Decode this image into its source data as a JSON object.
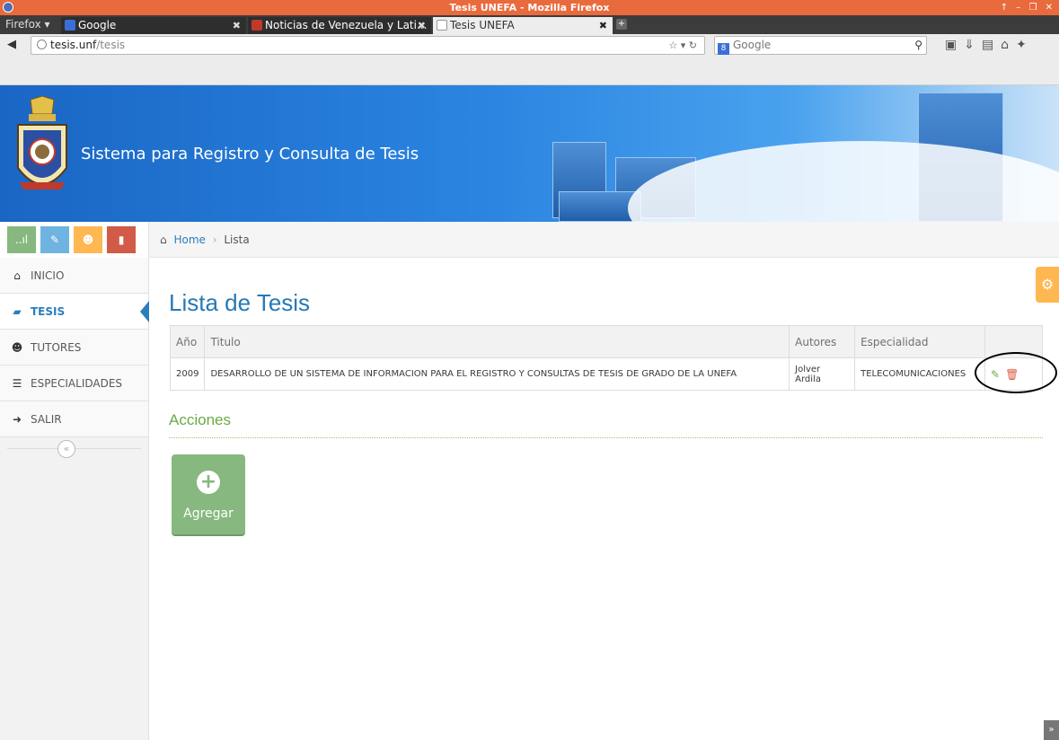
{
  "window": {
    "title": "Tesis UNEFA - Mozilla Firefox",
    "controls": "↑ – ❐ ✕"
  },
  "browser": {
    "menu_label": "Firefox ▾",
    "tabs": [
      {
        "label": "Google",
        "favicon_color": "#3b6fd8"
      },
      {
        "label": "Noticias de Venezuela y Lati...",
        "favicon_color": "#c0392b"
      },
      {
        "label": "Tesis UNEFA",
        "favicon_color": "#ffffff"
      }
    ],
    "url_host": "tesis.unf",
    "url_path": "/tesis",
    "url_controls": "☆ ▾ ↻",
    "search_engine_badge": "8",
    "search_placeholder": "Google"
  },
  "banner": {
    "site_title": "Sistema para Registro y Consulta de Tesis"
  },
  "sidebar": {
    "shortcuts": [
      {
        "name": "stats",
        "color": "#87b87f",
        "glyph": "..ıl"
      },
      {
        "name": "pencil",
        "color": "#6fb3e0",
        "glyph": "✎"
      },
      {
        "name": "users",
        "color": "#ffb752",
        "glyph": "☻"
      },
      {
        "name": "book",
        "color": "#d15b47",
        "glyph": "▮"
      }
    ],
    "items": [
      {
        "label": "INICIO",
        "icon": "home-icon",
        "glyph": "⌂"
      },
      {
        "label": "TESIS",
        "icon": "book-icon",
        "glyph": "▰"
      },
      {
        "label": "TUTORES",
        "icon": "group-icon",
        "glyph": "☻"
      },
      {
        "label": "ESPECIALIDADES",
        "icon": "list-icon",
        "glyph": "☰"
      },
      {
        "label": "SALIR",
        "icon": "logout-icon",
        "glyph": "➜"
      }
    ],
    "collapse_glyph": "«"
  },
  "breadcrumb": {
    "home": "Home",
    "current": "Lista"
  },
  "main": {
    "title": "Lista de Tesis",
    "table": {
      "headers": [
        "Año",
        "Titulo",
        "Autores",
        "Especialidad",
        ""
      ],
      "rows": [
        {
          "year": "2009",
          "title": "DESARROLLO DE UN SISTEMA DE INFORMACION PARA EL REGISTRO Y CONSULTAS DE TESIS DE GRADO DE LA UNEFA",
          "author": "Jolver Ardila",
          "specialty": "TELECOMUNICACIONES"
        }
      ]
    },
    "actions_heading": "Acciones",
    "add_label": "Agregar"
  },
  "colors": {
    "accent": "#2b7dbc",
    "success": "#87b87f",
    "warning": "#ffb752",
    "danger": "#d15b47"
  }
}
